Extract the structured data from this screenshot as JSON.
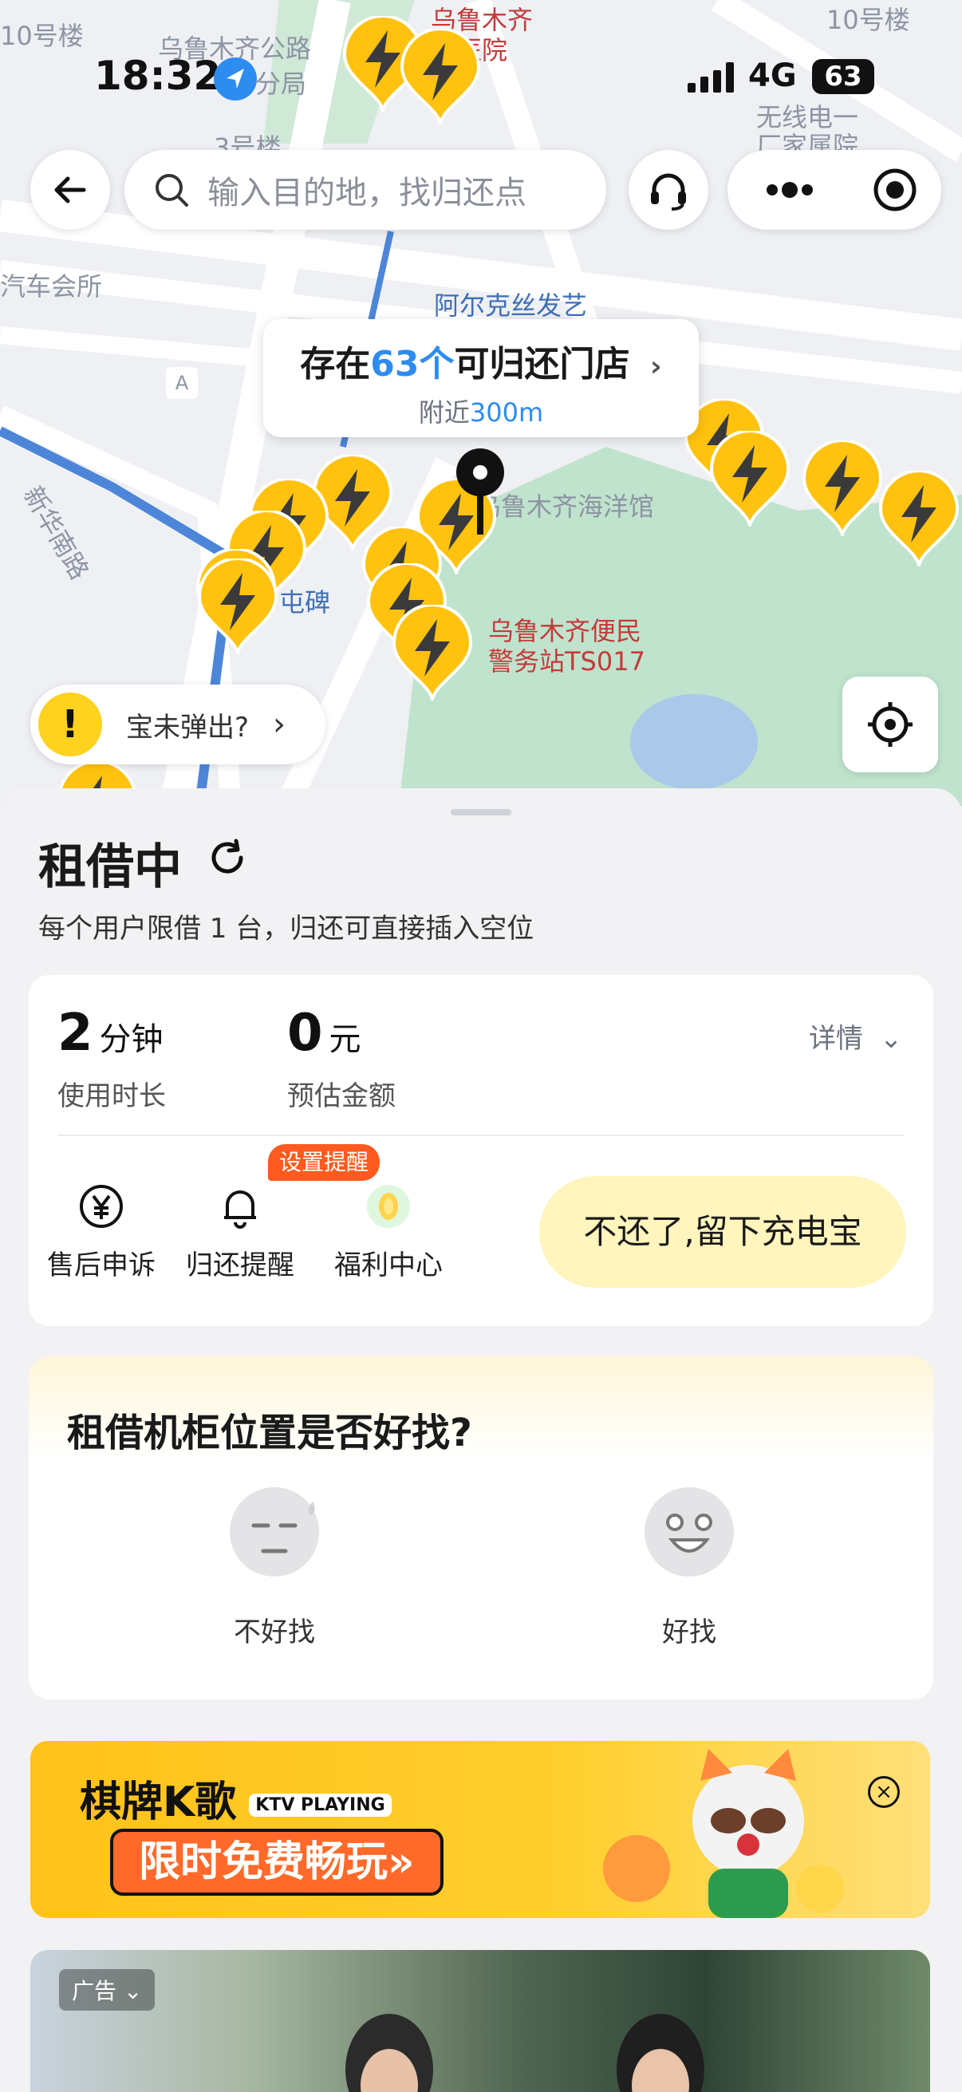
{
  "status_bar": {
    "time": "18:32",
    "network": "4G",
    "battery": "63"
  },
  "top_bar": {
    "search_placeholder": "输入目的地，找归还点"
  },
  "map": {
    "labels": {
      "building_10_left": "10号楼",
      "road_upper": "乌鲁木齐公路",
      "bureau": "分局",
      "hospital_1": "乌鲁木齐",
      "hospital_2": "二医院",
      "building_10_right": "10号楼",
      "factory_1": "无线电一",
      "factory_2": "厂家属院",
      "building_3": "3号楼",
      "club": "汽车会所",
      "salon": "阿尔克丝发艺",
      "road_a": "A",
      "xinhua_road": "新华南路",
      "aquarium": "乌鲁木齐海洋馆",
      "monument": "屯碑",
      "police_1": "乌鲁木齐便民",
      "police_2": "警务站TS017"
    },
    "store_bubble": {
      "prefix": "存在",
      "count": "63个",
      "suffix": "可归还门店",
      "nearby_prefix": "附近",
      "nearby_distance": "300m"
    },
    "not_popped": "宝未弹出?"
  },
  "sheet": {
    "title": "租借中",
    "subtitle": "每个用户限借 1 台，归还可直接插入空位",
    "rent": {
      "duration_value": "2",
      "duration_unit": "分钟",
      "duration_label": "使用时长",
      "amount_value": "0",
      "amount_unit": "元",
      "amount_label": "预估金额",
      "details": "详情"
    },
    "actions": [
      {
        "label": "售后申诉",
        "icon": "yuan-circle-icon"
      },
      {
        "label": "归还提醒",
        "icon": "bell-icon"
      },
      {
        "label": "福利中心",
        "icon": "gift-icon"
      }
    ],
    "remind_badge": "设置提醒",
    "keep_button": "不还了,留下充电宝",
    "survey": {
      "question": "租借机柜位置是否好找?",
      "bad": "不好找",
      "good": "好找"
    },
    "ad": {
      "line1": "棋牌K歌",
      "ktv": "KTV PLAYING",
      "line2": "限时免费畅玩»"
    },
    "ad_photo_tag": "广告"
  }
}
